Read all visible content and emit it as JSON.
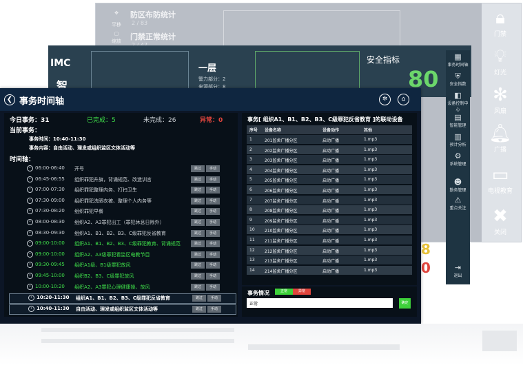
{
  "background": {
    "back_stats": [
      "防区布防统计",
      "门禁正常统计"
    ],
    "back_sub": [
      "2 / 83",
      "2 / 47"
    ],
    "back_tools": [
      "平移",
      "缩放"
    ],
    "right_nav": [
      {
        "label": "门禁",
        "icon": "lock-icon"
      },
      {
        "label": "灯光",
        "icon": "bulb-icon"
      },
      {
        "label": "风扇",
        "icon": "fan-icon"
      },
      {
        "label": "广播",
        "icon": "bell-icon"
      },
      {
        "label": "电视教育",
        "icon": "tv-icon"
      },
      {
        "label": "关闭",
        "icon": "close-icon"
      }
    ],
    "mid_logo": "IMC",
    "mid_char": "智",
    "mid_floor": "一层",
    "mid_small": [
      "警力部分：2",
      "来源部分：8"
    ],
    "mid_safe": "安全指标",
    "mid_score": "80",
    "side_nav": [
      "事务时间轴",
      "安全指数",
      "设备控制中心",
      "智能管理",
      "预计分析",
      "系统管理",
      "勤务管理",
      "重点关注",
      "退出"
    ],
    "digits": [
      "8",
      "0"
    ]
  },
  "header": {
    "title": "事务时间轴",
    "back_glyph": "❮",
    "settings_glyph": "✲",
    "home_glyph": "⌂"
  },
  "stats": {
    "today": "今日事务：31",
    "done": "已完成：5",
    "undone": "未完成：26",
    "abnormal": "异常：0"
  },
  "current": {
    "label": "当前事务：",
    "time": "事务时间：10:40-11:30",
    "content": "事务内容：自由活动、理发或组织监区文体活动等"
  },
  "timeline": {
    "label": "时间轴：",
    "btn_skip": "跳过",
    "btn_manual": "手动",
    "rows": [
      {
        "time": "06:00-06:40",
        "event": "开号",
        "state": "normal"
      },
      {
        "time": "06:45-06:55",
        "event": "组织罪犯升旗，背诵规范、改造训言",
        "state": "normal"
      },
      {
        "time": "07:00-07:30",
        "event": "组织罪犯整理内务、打扫卫生",
        "state": "normal"
      },
      {
        "time": "07:30-09:00",
        "event": "组织罪犯洗晒衣被、整理个人内务等",
        "state": "normal"
      },
      {
        "time": "07:30-08:20",
        "event": "组织罪犯早餐",
        "state": "normal"
      },
      {
        "time": "08:00-08:30",
        "event": "组织A2、A3罪犯出工（罪犯休息日除外）",
        "state": "normal"
      },
      {
        "time": "08:30-09:30",
        "event": "组织A1、B1、B2、B3、C级罪犯反省教育",
        "state": "normal"
      },
      {
        "time": "09:00-10:00",
        "event": "组织A1、B1、B2、B3、C级罪犯教育、背诵规范",
        "state": "done"
      },
      {
        "time": "09:00-10:00",
        "event": "组织A2、A3级罪犯看监区电教节目",
        "state": "done"
      },
      {
        "time": "09:30-09:45",
        "event": "组织A1级、B1级罪犯放风",
        "state": "done"
      },
      {
        "time": "09:45-10:00",
        "event": "组织B2、B3、C级罪犯放风",
        "state": "done"
      },
      {
        "time": "10:00-10:20",
        "event": "组织A2、A3罪犯心理健康操、放风",
        "state": "done"
      },
      {
        "time": "10:20-11:30",
        "event": "组织A1、B1、B2、B3、C级罪犯反省教育",
        "state": "active"
      },
      {
        "time": "10:40-11:30",
        "event": "自由活动、理发或组织监区文体活动等",
        "state": "active"
      }
    ]
  },
  "devices": {
    "title": "事务[ 组织A1、B1、B2、B3、C级罪犯反省教育 ]的联动设备",
    "columns": [
      "序号",
      "设备名称",
      "设备动作",
      "其他"
    ],
    "rows": [
      [
        "1",
        "201监舍广播分区",
        "启动广播",
        "1.mp3"
      ],
      [
        "2",
        "202监舍广播分区",
        "启动广播",
        "1.mp3"
      ],
      [
        "3",
        "203监舍广播分区",
        "启动广播",
        "1.mp3"
      ],
      [
        "4",
        "204监舍广播分区",
        "启动广播",
        "1.mp3"
      ],
      [
        "5",
        "205监舍广播分区",
        "启动广播",
        "1.mp3"
      ],
      [
        "6",
        "206监舍广播分区",
        "启动广播",
        "1.mp3"
      ],
      [
        "7",
        "207监舍广播分区",
        "启动广播",
        "1.mp3"
      ],
      [
        "8",
        "208监舍广播分区",
        "启动广播",
        "1.mp3"
      ],
      [
        "9",
        "209监舍广播分区",
        "启动广播",
        "1.mp3"
      ],
      [
        "10",
        "210监舍广播分区",
        "启动广播",
        "1.mp3"
      ],
      [
        "11",
        "211监舍广播分区",
        "启动广播",
        "1.mp3"
      ],
      [
        "12",
        "212监舍广播分区",
        "启动广播",
        "1.mp3"
      ],
      [
        "13",
        "213监舍广播分区",
        "启动广播",
        "1.mp3"
      ],
      [
        "14",
        "214监舍广播分区",
        "启动广播",
        "1.mp3"
      ]
    ]
  },
  "status": {
    "label": "事务情况",
    "on": "正常",
    "off": "异常",
    "input_value": "正常",
    "submit": "确定"
  },
  "colors": {
    "done_green": "#3fe04a",
    "abnormal_red": "#e0453d",
    "panel_bg": "#0c1626"
  }
}
